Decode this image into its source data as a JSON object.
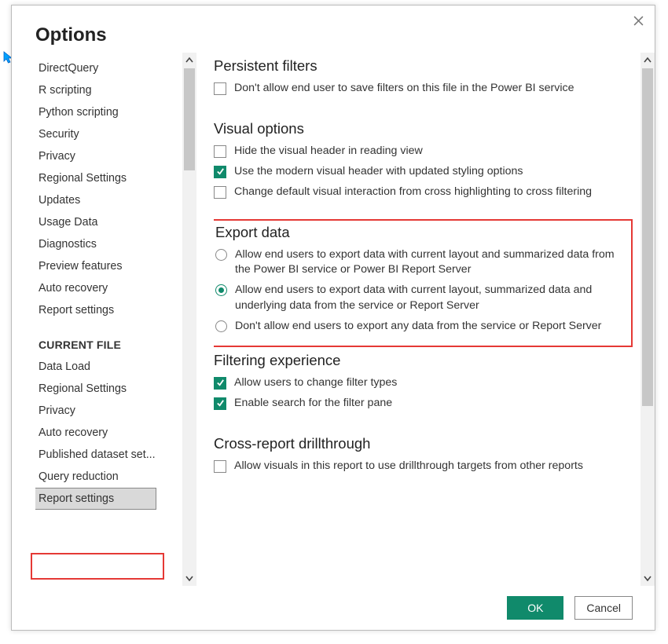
{
  "window": {
    "title": "Options"
  },
  "nav": {
    "global_items": [
      "DirectQuery",
      "R scripting",
      "Python scripting",
      "Security",
      "Privacy",
      "Regional Settings",
      "Updates",
      "Usage Data",
      "Diagnostics",
      "Preview features",
      "Auto recovery",
      "Report settings"
    ],
    "current_file_header": "CURRENT FILE",
    "current_file_items": [
      "Data Load",
      "Regional Settings",
      "Privacy",
      "Auto recovery",
      "Published dataset set...",
      "Query reduction",
      "Report settings"
    ],
    "selected_item": "Report settings"
  },
  "sections": {
    "persistent_filters": {
      "title": "Persistent filters",
      "opt1": {
        "label": "Don't allow end user to save filters on this file in the Power BI service",
        "checked": false
      }
    },
    "visual_options": {
      "title": "Visual options",
      "opt1": {
        "label": "Hide the visual header in reading view",
        "checked": false
      },
      "opt2": {
        "label": "Use the modern visual header with updated styling options",
        "checked": true
      },
      "opt3": {
        "label": "Change default visual interaction from cross highlighting to cross filtering",
        "checked": false
      }
    },
    "export_data": {
      "title": "Export data",
      "opt1": {
        "label": "Allow end users to export data with current layout and summarized data from the Power BI service or Power BI Report Server",
        "selected": false
      },
      "opt2": {
        "label": "Allow end users to export data with current layout, summarized data and underlying data from the service or Report Server",
        "selected": true
      },
      "opt3": {
        "label": "Don't allow end users to export any data from the service or Report Server",
        "selected": false
      }
    },
    "filtering_experience": {
      "title": "Filtering experience",
      "opt1": {
        "label": "Allow users to change filter types",
        "checked": true
      },
      "opt2": {
        "label": "Enable search for the filter pane",
        "checked": true
      }
    },
    "cross_report": {
      "title": "Cross-report drillthrough",
      "opt1": {
        "label": "Allow visuals in this report to use drillthrough targets from other reports",
        "checked": false
      }
    }
  },
  "footer": {
    "ok": "OK",
    "cancel": "Cancel"
  }
}
